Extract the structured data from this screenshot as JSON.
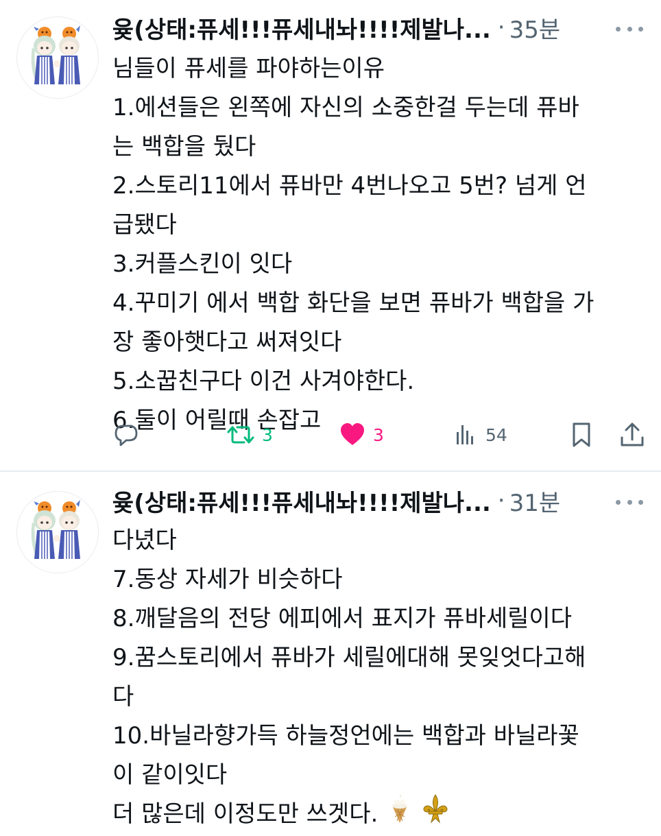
{
  "colors": {
    "text": "#0f1419",
    "secondary": "#536471",
    "retweet_green": "#00ba7c",
    "like_pink": "#f91880",
    "divider": "#e6ecf0"
  },
  "tweets": [
    {
      "author": "윶(상태:퓨세!!!퓨세내놔!!!!제발나...",
      "separator": "·",
      "time": "35분",
      "lines": [
        "님들이 퓨세를 파야하는이유",
        "1.에션들은 왼쪽에 자신의 소중한걸 두는데 퓨바",
        "는 백합을 뒀다",
        "2.스토리11에서 퓨바만 4번나오고 5번? 넘게 언",
        "급됐다",
        "3.커플스킨이 잇다",
        "4.꾸미기 에서 백합 화단을 보면 퓨바가 백합을 가",
        "장 좋아햇다고 써져잇다",
        "5.소꿉친구다 이건 사겨야한다.",
        "6.둘이 어릴때 손잡고"
      ],
      "actions": {
        "reply_icon": "reply-icon",
        "retweet_icon": "retweet-icon",
        "retweets": "3",
        "like_icon": "heart-filled-icon",
        "likes": "3",
        "views_icon": "views-icon",
        "views": "54",
        "bookmark_icon": "bookmark-icon",
        "share_icon": "share-icon"
      }
    },
    {
      "author": "윶(상태:퓨세!!!퓨세내놔!!!!제발나...",
      "separator": "·",
      "time": "31분",
      "lines": [
        "다녔다",
        "7.동상 자세가 비슷하다",
        "8.깨달음의 전당 에피에서 표지가 퓨바세릴이다",
        "9.꿈스토리에서 퓨바가 세릴에대해 못잊엇다고해",
        "다",
        "10.바닐라향가득 하늘정언에는 백합과 바닐라꽃",
        "이 같이잇다",
        "더 많은데 이정도만 쓰겟다."
      ],
      "emojis": [
        "soft-ice-cream-emoji",
        "fleur-de-lis-emoji"
      ]
    }
  ]
}
